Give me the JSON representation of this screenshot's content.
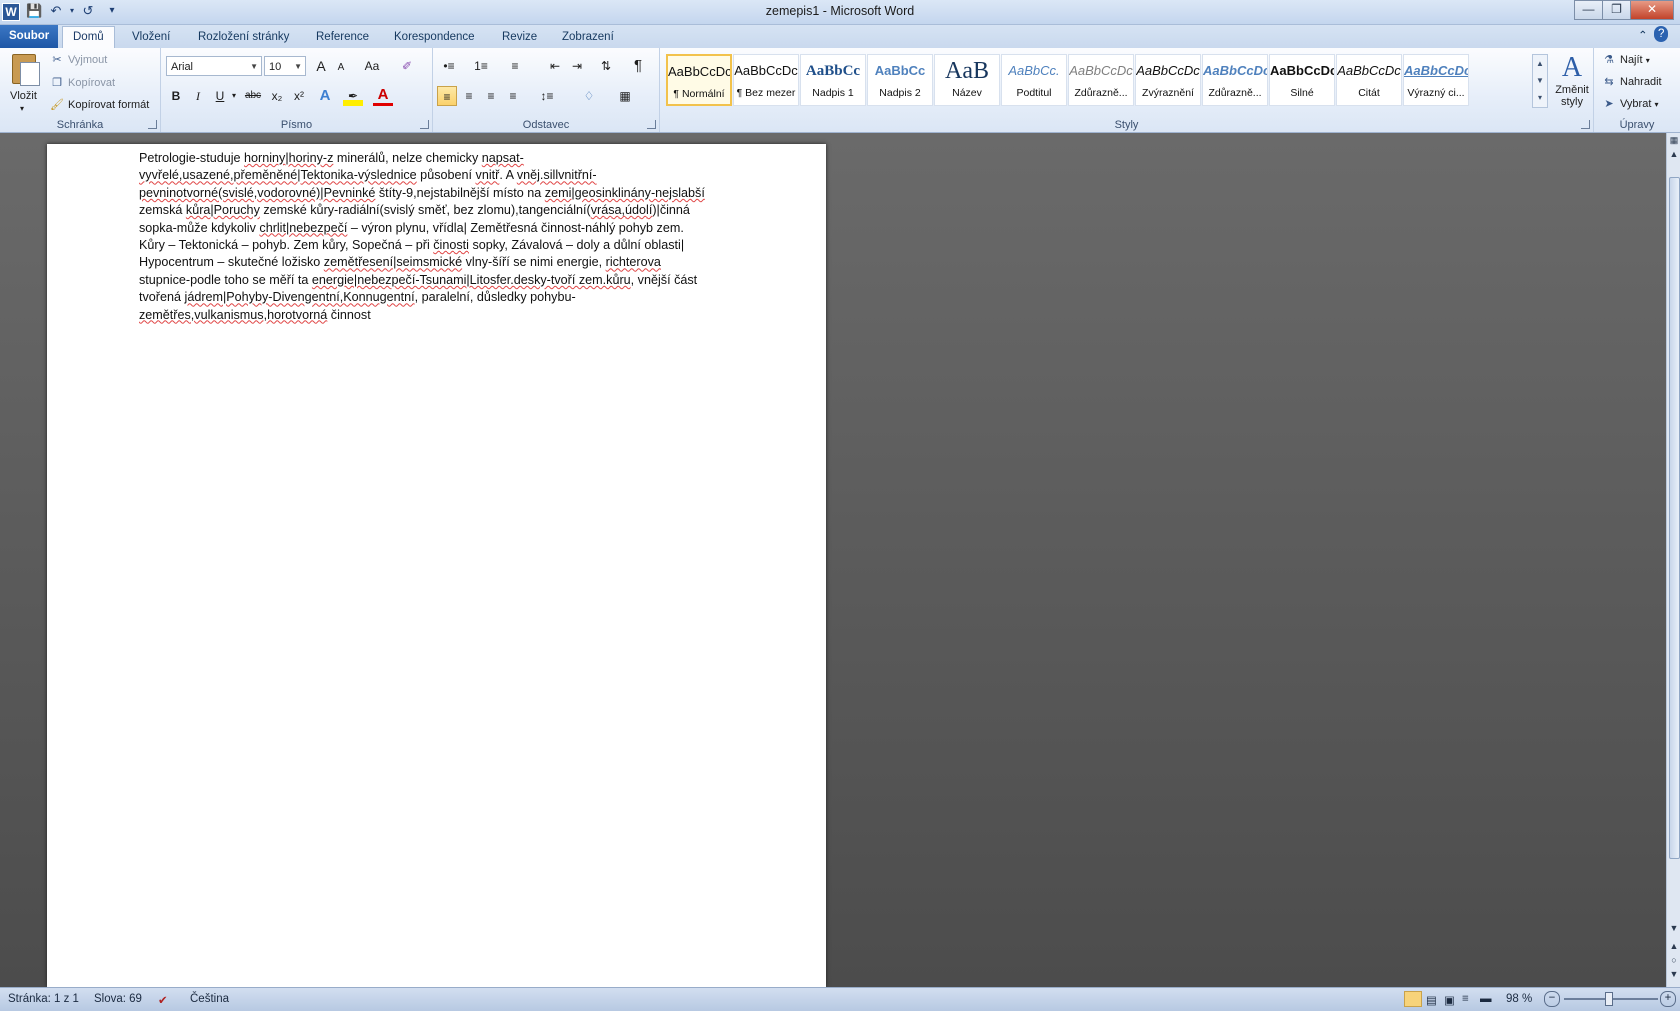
{
  "window": {
    "title": "zemepis1  -  Microsoft Word",
    "app_icon_letter": "W"
  },
  "tabs": [
    "Soubor",
    "Domů",
    "Vložení",
    "Rozložení stránky",
    "Reference",
    "Korespondence",
    "Revize",
    "Zobrazení"
  ],
  "active_tab": "Domů",
  "clipboard": {
    "paste": "Vložit",
    "cut": "Vyjmout",
    "copy": "Kopírovat",
    "format_painter": "Kopírovat formát",
    "label": "Schránka"
  },
  "font": {
    "name": "Arial",
    "size": "10",
    "label": "Písmo",
    "bold": "B",
    "italic": "I",
    "underline": "U",
    "strike": "abc",
    "sub": "x₂",
    "sup": "x²",
    "grow": "A",
    "shrink": "A",
    "case": "Aa"
  },
  "paragraph": {
    "label": "Odstavec",
    "pilcrow": "¶"
  },
  "styles": {
    "label": "Styly",
    "items": [
      {
        "preview": "AaBbCcDc",
        "name": "¶ Normální"
      },
      {
        "preview": "AaBbCcDc",
        "name": "¶ Bez mezer"
      },
      {
        "preview": "AaBbCc",
        "name": "Nadpis 1"
      },
      {
        "preview": "AaBbCc",
        "name": "Nadpis 2"
      },
      {
        "preview": "AaB",
        "name": "Název"
      },
      {
        "preview": "AaBbCc.",
        "name": "Podtitul"
      },
      {
        "preview": "AaBbCcDc",
        "name": "Zdůrazně..."
      },
      {
        "preview": "AaBbCcDc",
        "name": "Zvýraznění"
      },
      {
        "preview": "AaBbCcDc",
        "name": "Zdůrazně..."
      },
      {
        "preview": "AaBbCcDc",
        "name": "Silné"
      },
      {
        "preview": "AaBbCcDc",
        "name": "Citát"
      },
      {
        "preview": "AaBbCcDc",
        "name": "Výrazný ci..."
      }
    ],
    "change_styles_line1": "Změnit",
    "change_styles_line2": "styly"
  },
  "editing": {
    "label": "Úpravy",
    "find": "Najít",
    "replace": "Nahradit",
    "select": "Vybrat"
  },
  "document": {
    "lines": [
      [
        "Petrologie-studuje ",
        {
          "s": "horniny|horiny-z"
        },
        " minerálů, nelze chemicky ",
        {
          "s": "napsat-"
        }
      ],
      [
        {
          "s": "vyvřelé,usazené,přeměněné|Tektonika-výslednice"
        },
        " působení ",
        {
          "s": "vnitř"
        },
        ". A ",
        {
          "s": "vněj.sillvnitřní-"
        }
      ],
      [
        {
          "s": "pevninotvorné(svislé,vodorovné)|Pevninké"
        },
        " štíty-9,nejstabilnější místo na ",
        {
          "s": "zemi|geosinklinány-nejslabší"
        }
      ],
      [
        "zemská ",
        {
          "s": "kůra|Poruchy"
        },
        " zemské kůry-radiální(svislý směť, bez zlomu),tangenciální(",
        {
          "s": "vrása,údolí"
        },
        ")|činná"
      ],
      [
        "sopka-může kdykoliv ",
        {
          "s": "chrlit|nebezpečí"
        },
        " – výron plynu, vřídla| Zemětřesná činnost-náhlý pohyb zem."
      ],
      [
        "Kůry – Tektonická – pohyb. Zem kůry, Sopečná – při ",
        {
          "s": "činosti"
        },
        " sopky, Závalová – doly a důlní oblasti|"
      ],
      [
        "Hypocentrum – skutečné ložisko ",
        {
          "s": "zemětřesení|seimsmické"
        },
        " vlny-šíří se nimi energie, ",
        {
          "s": "richterova"
        }
      ],
      [
        "stupnice-podle toho se měří ta ",
        {
          "s": "energie|nebezpečí-Tsunami|Litosfer.desky-tvoří zem.kůru"
        },
        ", vnější část"
      ],
      [
        "tvořená ",
        {
          "s": "jádrem|Pohyby-Divengentní,Konnugentní"
        },
        ", paralelní, důsledky pohybu-"
      ],
      [
        {
          "s": "zemětřes,vulkanismus,horotvorná"
        },
        " činnost"
      ]
    ]
  },
  "status": {
    "page": "Stránka: 1 z 1",
    "words": "Slova: 69",
    "language": "Čeština",
    "zoom": "98 %"
  },
  "colors": {
    "file_tab": "#1e57a6",
    "selection_highlight": "#fbd16a",
    "spellcheck": "#e04545"
  }
}
